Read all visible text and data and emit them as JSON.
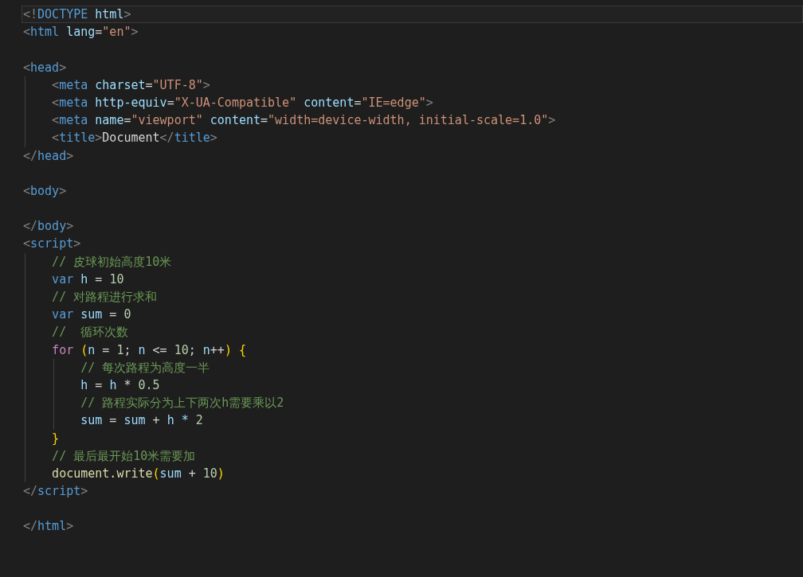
{
  "editor": {
    "lines": [
      {
        "current": true,
        "tokens": [
          {
            "color": "#808080",
            "t": "<!"
          },
          {
            "color": "#569cd6",
            "t": "DOCTYPE"
          },
          {
            "color": "#9cdcfe",
            "t": " html"
          },
          {
            "color": "#808080",
            "t": ">"
          }
        ]
      },
      {
        "current": false,
        "tokens": [
          {
            "color": "#808080",
            "t": "<"
          },
          {
            "color": "#569cd6",
            "t": "html"
          },
          {
            "color": "#9cdcfe",
            "t": " lang"
          },
          {
            "color": "#d4d4d4",
            "t": "="
          },
          {
            "color": "#ce9178",
            "t": "\"en\""
          },
          {
            "color": "#808080",
            "t": ">"
          }
        ]
      },
      {
        "current": false
      },
      {
        "current": false,
        "tokens": [
          {
            "color": "#808080",
            "t": "<"
          },
          {
            "color": "#569cd6",
            "t": "head"
          },
          {
            "color": "#808080",
            "t": ">"
          }
        ]
      },
      {
        "current": false,
        "tokens": [
          {
            "color": "#808080",
            "t": "    <"
          },
          {
            "color": "#569cd6",
            "t": "meta"
          },
          {
            "color": "#9cdcfe",
            "t": " charset"
          },
          {
            "color": "#d4d4d4",
            "t": "="
          },
          {
            "color": "#ce9178",
            "t": "\"UTF-8\""
          },
          {
            "color": "#808080",
            "t": ">"
          }
        ]
      },
      {
        "current": false,
        "tokens": [
          {
            "color": "#808080",
            "t": "    <"
          },
          {
            "color": "#569cd6",
            "t": "meta"
          },
          {
            "color": "#9cdcfe",
            "t": " http-equiv"
          },
          {
            "color": "#d4d4d4",
            "t": "="
          },
          {
            "color": "#ce9178",
            "t": "\"X-UA-Compatible\""
          },
          {
            "color": "#9cdcfe",
            "t": " content"
          },
          {
            "color": "#d4d4d4",
            "t": "="
          },
          {
            "color": "#ce9178",
            "t": "\"IE=edge\""
          },
          {
            "color": "#808080",
            "t": ">"
          }
        ]
      },
      {
        "current": false,
        "tokens": [
          {
            "color": "#808080",
            "t": "    <"
          },
          {
            "color": "#569cd6",
            "t": "meta"
          },
          {
            "color": "#9cdcfe",
            "t": " name"
          },
          {
            "color": "#d4d4d4",
            "t": "="
          },
          {
            "color": "#ce9178",
            "t": "\"viewport\""
          },
          {
            "color": "#9cdcfe",
            "t": " content"
          },
          {
            "color": "#d4d4d4",
            "t": "="
          },
          {
            "color": "#ce9178",
            "t": "\"width=device-width, initial-scale=1.0\""
          },
          {
            "color": "#808080",
            "t": ">"
          }
        ]
      },
      {
        "current": false,
        "tokens": [
          {
            "color": "#808080",
            "t": "    <"
          },
          {
            "color": "#569cd6",
            "t": "title"
          },
          {
            "color": "#808080",
            "t": ">"
          },
          {
            "color": "#d4d4d4",
            "t": "Document"
          },
          {
            "color": "#808080",
            "t": "</"
          },
          {
            "color": "#569cd6",
            "t": "title"
          },
          {
            "color": "#808080",
            "t": ">"
          }
        ]
      },
      {
        "current": false,
        "tokens": [
          {
            "color": "#808080",
            "t": "</"
          },
          {
            "color": "#569cd6",
            "t": "head"
          },
          {
            "color": "#808080",
            "t": ">"
          }
        ]
      },
      {
        "current": false
      },
      {
        "current": false,
        "tokens": [
          {
            "color": "#808080",
            "t": "<"
          },
          {
            "color": "#569cd6",
            "t": "body"
          },
          {
            "color": "#808080",
            "t": ">"
          }
        ]
      },
      {
        "current": false
      },
      {
        "current": false,
        "tokens": [
          {
            "color": "#808080",
            "t": "</"
          },
          {
            "color": "#569cd6",
            "t": "body"
          },
          {
            "color": "#808080",
            "t": ">"
          }
        ]
      },
      {
        "current": false,
        "tokens": [
          {
            "color": "#808080",
            "t": "<"
          },
          {
            "color": "#569cd6",
            "t": "script"
          },
          {
            "color": "#808080",
            "t": ">"
          }
        ]
      },
      {
        "current": false,
        "tokens": [
          {
            "color": "#6a9955",
            "t": "    // 皮球初始高度10米"
          }
        ]
      },
      {
        "current": false,
        "tokens": [
          {
            "color": "#569cd6",
            "t": "    var"
          },
          {
            "color": "#9cdcfe",
            "t": " h"
          },
          {
            "color": "#d4d4d4",
            "t": " = "
          },
          {
            "color": "#b5cea8",
            "t": "10"
          }
        ]
      },
      {
        "current": false,
        "tokens": [
          {
            "color": "#6a9955",
            "t": "    // 对路程进行求和"
          }
        ]
      },
      {
        "current": false,
        "tokens": [
          {
            "color": "#569cd6",
            "t": "    var"
          },
          {
            "color": "#9cdcfe",
            "t": " sum"
          },
          {
            "color": "#d4d4d4",
            "t": " = "
          },
          {
            "color": "#b5cea8",
            "t": "0"
          }
        ]
      },
      {
        "current": false,
        "tokens": [
          {
            "color": "#6a9955",
            "t": "    //  循环次数"
          }
        ]
      },
      {
        "current": false,
        "tokens": [
          {
            "color": "#c586c0",
            "t": "    for"
          },
          {
            "color": "#ffd700",
            "t": " ("
          },
          {
            "color": "#9cdcfe",
            "t": "n"
          },
          {
            "color": "#d4d4d4",
            "t": " = "
          },
          {
            "color": "#b5cea8",
            "t": "1"
          },
          {
            "color": "#d4d4d4",
            "t": "; "
          },
          {
            "color": "#9cdcfe",
            "t": "n"
          },
          {
            "color": "#d4d4d4",
            "t": " <= "
          },
          {
            "color": "#b5cea8",
            "t": "10"
          },
          {
            "color": "#d4d4d4",
            "t": "; "
          },
          {
            "color": "#9cdcfe",
            "t": "n"
          },
          {
            "color": "#d4d4d4",
            "t": "++"
          },
          {
            "color": "#ffd700",
            "t": ") {"
          }
        ]
      },
      {
        "current": false,
        "tokens": [
          {
            "color": "#6a9955",
            "t": "        // 每次路程为高度一半"
          }
        ]
      },
      {
        "current": false,
        "tokens": [
          {
            "color": "#9cdcfe",
            "t": "        h"
          },
          {
            "t": " = "
          },
          {
            "color": "#9cdcfe",
            "t": "h"
          },
          {
            "t": " * "
          },
          {
            "color": "#b5cea8",
            "t": "0.5"
          }
        ]
      },
      {
        "current": false,
        "tokens": [
          {
            "color": "#6a9955",
            "t": "        // 路程实际分为上下两次h需要乘以2"
          }
        ]
      },
      {
        "current": false,
        "tokens": [
          {
            "color": "#9cdcfe",
            "t": "        sum"
          },
          {
            "t": " = "
          },
          {
            "color": "#9cdcfe",
            "t": "sum"
          },
          {
            "t": " + "
          },
          {
            "color": "#9cdcfe",
            "t": "h * "
          },
          {
            "color": "#b5cea8",
            "t": "2"
          }
        ]
      },
      {
        "current": false,
        "tokens": [
          {
            "color": "#ffd700",
            "t": "    }"
          }
        ]
      },
      {
        "current": false,
        "tokens": [
          {
            "color": "#6a9955",
            "t": "    // 最后最开始10米需要加"
          }
        ]
      },
      {
        "current": false,
        "tokens": [
          {
            "color": "#dcdcaa",
            "t": "    document.write"
          },
          {
            "color": "#ffd700",
            "t": "("
          },
          {
            "color": "#9cdcfe",
            "t": "sum"
          },
          {
            "color": "#d4d4d4",
            "t": " + "
          },
          {
            "color": "#b5cea8",
            "t": "10"
          },
          {
            "color": "#ffd700",
            "t": ")"
          }
        ]
      },
      {
        "current": false,
        "tokens": [
          {
            "color": "#808080",
            "t": "</"
          },
          {
            "color": "#569cd6",
            "t": "script"
          },
          {
            "color": "#808080",
            "t": ">"
          }
        ]
      },
      {
        "current": false
      },
      {
        "current": false,
        "tokens": [
          {
            "color": "#808080",
            "t": "</"
          },
          {
            "color": "#569cd6",
            "t": "html"
          },
          {
            "color": "#808080",
            "t": ">"
          }
        ]
      }
    ]
  }
}
